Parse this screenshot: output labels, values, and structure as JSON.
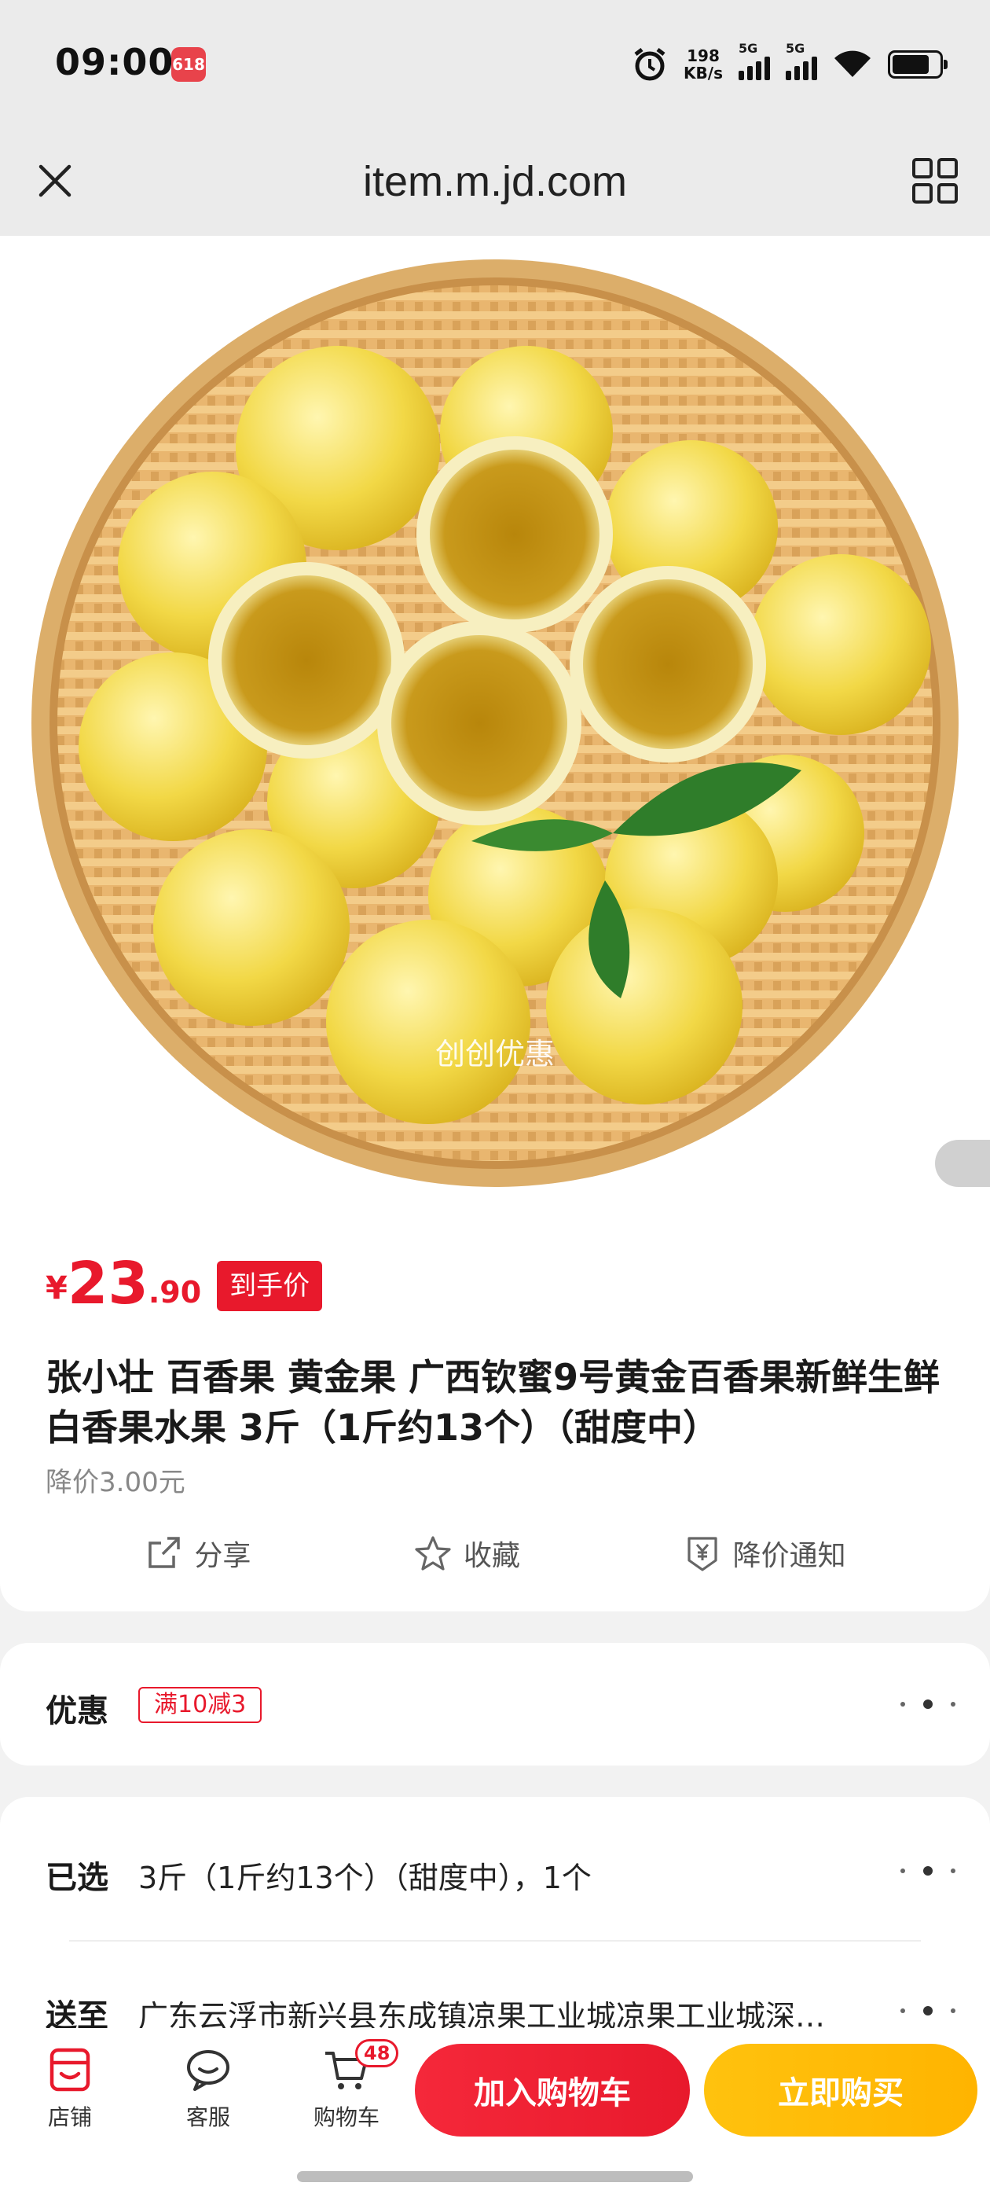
{
  "status_bar": {
    "time": "09:00",
    "app_icon_text": "618",
    "net_speed_value": "198",
    "net_speed_unit": "KB/s",
    "signal1_label": "5G",
    "signal2_label": "5G"
  },
  "browser": {
    "url": "item.m.jd.com",
    "close_icon": "close-icon",
    "grid_icon": "grid-icon"
  },
  "product_image": {
    "watermark": "创创优惠"
  },
  "price": {
    "symbol": "¥",
    "integer": "23",
    "decimal": ".90",
    "badge": "到手价"
  },
  "product": {
    "title": "张小壮 百香果 黄金果 广西钦蜜9号黄金百香果新鲜生鲜白香果水果 3斤（1斤约13个）（甜度中）",
    "price_drop": "降价3.00元"
  },
  "actions": [
    {
      "label": "分享",
      "icon": "share-icon"
    },
    {
      "label": "收藏",
      "icon": "star-icon"
    },
    {
      "label": "降价通知",
      "icon": "price-alert-icon"
    }
  ],
  "promo": {
    "label": "优惠",
    "coupon": "满10减3"
  },
  "selection": {
    "selected_label": "已选",
    "selected_value": "3斤（1斤约13个）（甜度中），1个",
    "ship_label": "送至",
    "ship_value": "广东云浮市新兴县东成镇凉果工业城凉果工业城深…"
  },
  "bottom_bar": {
    "tabs": [
      {
        "label": "店铺",
        "icon": "store-icon"
      },
      {
        "label": "客服",
        "icon": "customer-service-icon"
      },
      {
        "label": "购物车",
        "icon": "cart-icon",
        "badge": "48"
      }
    ],
    "add_to_cart": "加入购物车",
    "buy_now": "立即购买"
  },
  "colors": {
    "accent_red": "#e8192c",
    "accent_yellow": "#ffb400"
  }
}
